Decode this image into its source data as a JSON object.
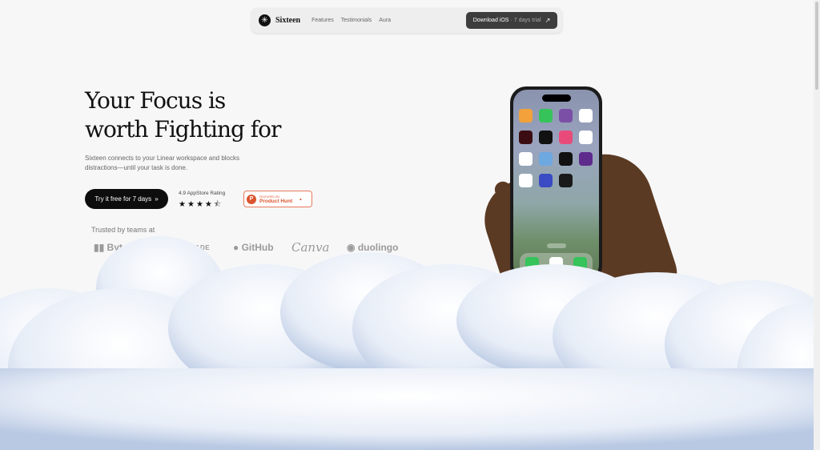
{
  "nav": {
    "brand": "Sixteen",
    "links": [
      "Features",
      "Testimonials",
      "Aura"
    ],
    "cta_main": "Download iOS",
    "cta_sub": "· 7 days trial"
  },
  "hero": {
    "title_line1": "Your Focus is",
    "title_line2": "worth Fighting for",
    "subtitle": "Sixteen connects to your Linear workspace and blocks distractions—until your task is done.",
    "cta_label": "Try it free for 7 days",
    "rating_label": "4.9 AppStore Rating",
    "rating_value": 4.5,
    "rating_max": 5,
    "ph_small": "FEATURED ON",
    "ph_name": "Product Hunt"
  },
  "trusted": {
    "label": "Trusted by teams at",
    "brands": [
      "ByteDance",
      "TRADE",
      "GitHub",
      "Canva",
      "duolingo"
    ]
  },
  "colors": {
    "background": "#f7f7f8",
    "cta": "#0d0d0d",
    "producthunt": "#da552f"
  }
}
